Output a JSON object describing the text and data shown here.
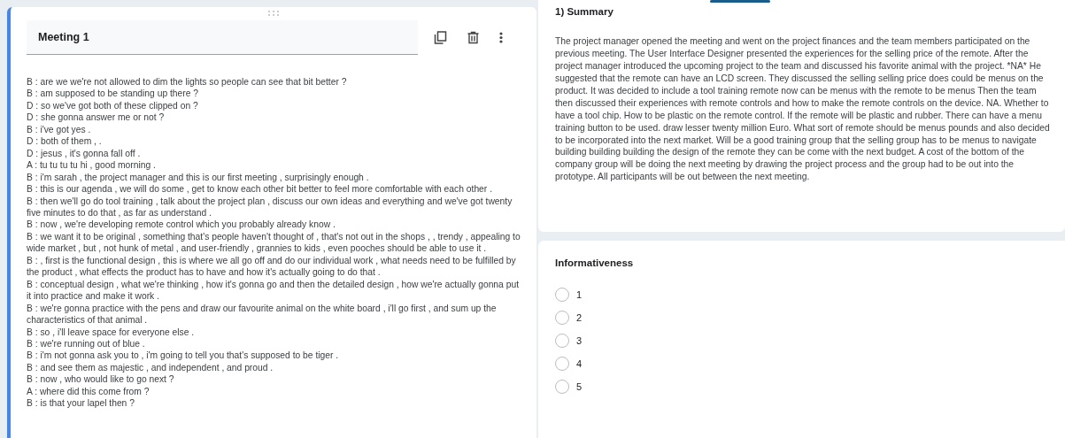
{
  "question_card": {
    "title": "Meeting 1",
    "transcript": [
      "B : are we we're not allowed to dim the lights so people can see that bit better ?",
      "B : am supposed to be standing up there ?",
      "D : so we've got both of these clipped on ?",
      "D : she gonna answer me or not ?",
      "B : i've got yes .",
      "D : both of them , .",
      "D : jesus , it's gonna fall off .",
      "A : tu tu tu tu hi , good morning .",
      "B : i'm sarah , the project manager and this is our first meeting , surprisingly enough .",
      "B : this is our agenda , we will do some , get to know each other bit better to feel more comfortable with each other .",
      "B : then we'll go do tool training , talk about the project plan , discuss our own ideas and everything and we've got twenty five minutes to do that , as far as understand .",
      "B : now , we're developing remote control which you probably already know .",
      "B : we want it to be original , something that's people haven't thought of , that's not out in the shops , , trendy , appealing to wide market , but , not hunk of metal , and user-friendly , grannies to kids , even pooches should be able to use it .",
      "B : , first is the functional design , this is where we all go off and do our individual work , what needs need to be fulfilled by the product , what effects the product has to have and how it's actually going to do that .",
      "B : conceptual design , what we're thinking , how it's gonna go and then the detailed design , how we're actually gonna put it into practice and make it work .",
      "B : we're gonna practice with the pens and draw our favourite animal on the white board , i'll go first , and sum up the characteristics of that animal .",
      "B : so , i'll leave space for everyone else .",
      "B : we're running out of blue .",
      "B : i'm not gonna ask you to , i'm going to tell you that's supposed to be tiger .",
      "B : and see them as majestic , and independent , and proud .",
      "B : now , who would like to go next ?",
      "A : where did this come from ?",
      "B : is that your lapel then ?"
    ]
  },
  "summary_card": {
    "heading": "1) Summary",
    "text": "The project manager opened the meeting and went on the project finances and the team members participated on the previous meeting. The User Interface Designer presented the experiences for the selling price of the remote. After the project manager introduced the upcoming project to the team and discussed his favorite animal with the project. *NA* He suggested that the remote can have an LCD screen. They discussed the selling selling price does could be menus on the product. It was decided to include a tool training remote now can be menus with the remote to be menus Then the team then discussed their experiences with remote controls and how to make the remote controls on the device. NA. Whether to have a tool chip. How to be plastic on the remote control. If the remote will be plastic and rubber. There can have a menu training button to be used. draw lesser twenty million Euro. What sort of remote should be menus pounds and also decided to be incorporated into the next market. Will be a good training group that the selling group has to be menus to navigate building building building the design of the remote they can be come with the next budget. A cost of the bottom of the company group will be doing the next meeting by drawing the project process and the group had to be out into the prototype. All participants will be out between the next meeting."
  },
  "rating_card": {
    "title": "Informativeness",
    "options": [
      {
        "label": "1",
        "selected": false
      },
      {
        "label": "2",
        "selected": false
      },
      {
        "label": "3",
        "selected": false
      },
      {
        "label": "4",
        "selected": false
      },
      {
        "label": "5",
        "selected": false
      }
    ]
  }
}
